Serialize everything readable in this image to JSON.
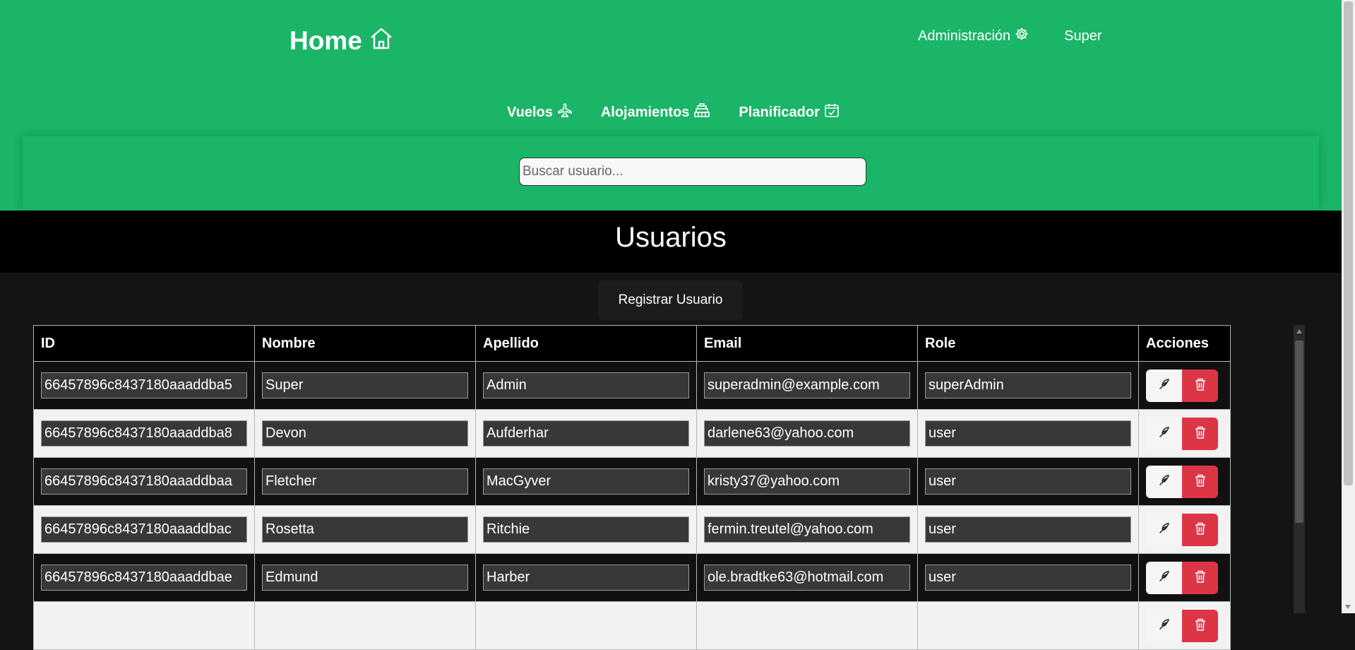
{
  "header": {
    "home_label": "Home",
    "admin_label": "Administración",
    "user_label": "Super",
    "nav": [
      {
        "label": "Vuelos",
        "icon": "airplane-icon"
      },
      {
        "label": "Alojamientos",
        "icon": "hotel-icon"
      },
      {
        "label": "Planificador",
        "icon": "calendar-check-icon"
      }
    ]
  },
  "search": {
    "placeholder": "Buscar usuario..."
  },
  "page": {
    "title": "Usuarios",
    "register_button": "Registrar Usuario"
  },
  "table": {
    "headers": [
      "ID",
      "Nombre",
      "Apellido",
      "Email",
      "Role",
      "Acciones"
    ],
    "rows": [
      {
        "id": "66457896c8437180aaaddba5",
        "nombre": "Super",
        "apellido": "Admin",
        "email": "superadmin@example.com",
        "role": "superAdmin"
      },
      {
        "id": "66457896c8437180aaaddba8",
        "nombre": "Devon",
        "apellido": "Aufderhar",
        "email": "darlene63@yahoo.com",
        "role": "user"
      },
      {
        "id": "66457896c8437180aaaddbaa",
        "nombre": "Fletcher",
        "apellido": "MacGyver",
        "email": "kristy37@yahoo.com",
        "role": "user"
      },
      {
        "id": "66457896c8437180aaaddbac",
        "nombre": "Rosetta",
        "apellido": "Ritchie",
        "email": "fermin.treutel@yahoo.com",
        "role": "user"
      },
      {
        "id": "66457896c8437180aaaddbae",
        "nombre": "Edmund",
        "apellido": "Harber",
        "email": "ole.bradtke63@hotmail.com",
        "role": "user"
      },
      {
        "id": "",
        "nombre": "",
        "apellido": "",
        "email": "",
        "role": ""
      }
    ]
  },
  "colors": {
    "header_green": "#1ab567",
    "delete_red": "#dc3545",
    "background": "#141414"
  }
}
